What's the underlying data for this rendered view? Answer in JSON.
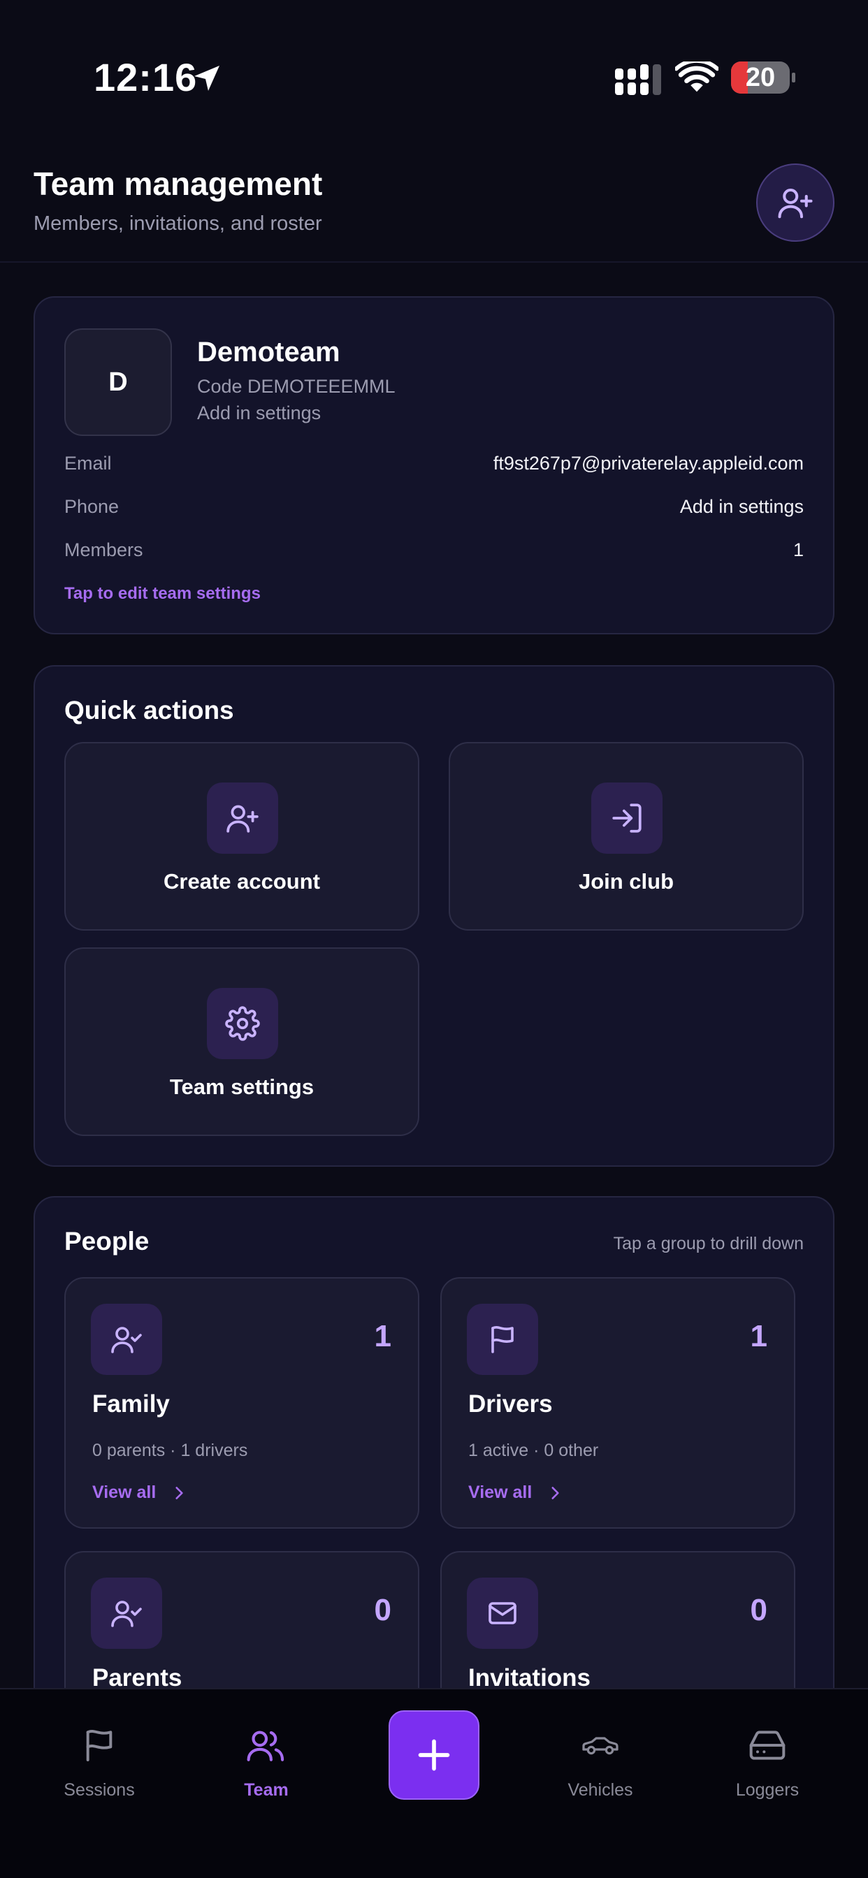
{
  "status_bar": {
    "time": "12:16",
    "battery": "20"
  },
  "header": {
    "title": "Team management",
    "subtitle": "Members, invitations, and roster",
    "add_member_icon": "user-plus-icon"
  },
  "team": {
    "initial": "D",
    "name": "Demoteam",
    "code": "Code DEMOTEEEMML",
    "location": "Add in settings",
    "rows": [
      {
        "label": "Email",
        "value": "ft9st267p7@privaterelay.appleid.com"
      },
      {
        "label": "Phone",
        "value": "Add in settings"
      },
      {
        "label": "Members",
        "value": "1"
      }
    ],
    "edit_link": "Tap to edit team settings"
  },
  "quick_actions": {
    "title": "Quick actions",
    "items": [
      {
        "label": "Create account",
        "icon": "user-plus-icon"
      },
      {
        "label": "Join club",
        "icon": "sign-in-icon"
      },
      {
        "label": "Team settings",
        "icon": "gear-icon"
      }
    ]
  },
  "people": {
    "title": "People",
    "hint": "Tap a group to drill down",
    "groups": [
      {
        "name": "Family",
        "count": "1",
        "meta": "0 parents · 1 drivers",
        "link": "View all",
        "icon": "user-check-icon"
      },
      {
        "name": "Drivers",
        "count": "1",
        "meta": "1 active · 0 other",
        "link": "View all",
        "icon": "flag-icon"
      },
      {
        "name": "Parents",
        "count": "0",
        "icon": "user-check-icon"
      },
      {
        "name": "Invitations",
        "count": "0",
        "icon": "mail-icon"
      }
    ]
  },
  "tab_bar": {
    "tabs": [
      {
        "label": "Sessions",
        "icon": "flag-icon"
      },
      {
        "label": "Team",
        "icon": "users-icon",
        "active": true
      },
      {
        "label": "Vehicles",
        "icon": "car-icon"
      },
      {
        "label": "Loggers",
        "icon": "hard-drive-icon"
      }
    ],
    "fab_icon": "plus-icon"
  },
  "colors": {
    "background": "#0b0b16",
    "card": "#13132a",
    "accent": "#a66cf0",
    "fab": "#7b2ff0",
    "count": "#c4a6ff"
  }
}
